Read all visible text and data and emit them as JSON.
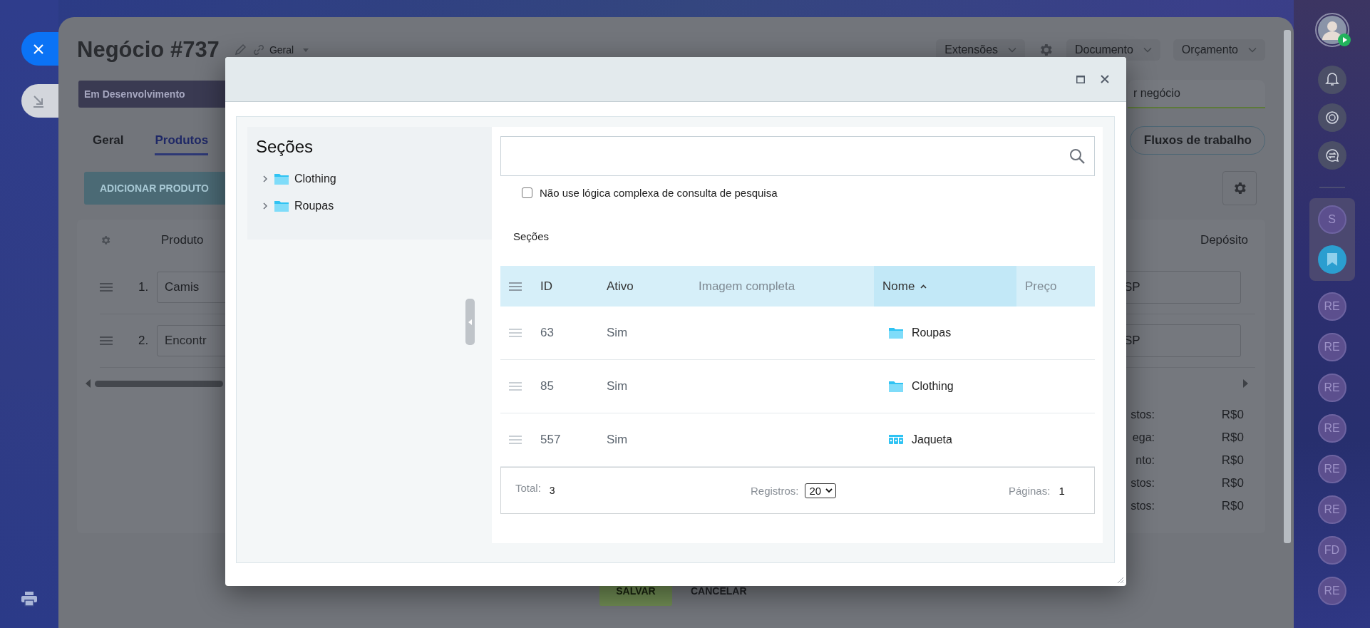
{
  "deal": {
    "title": "Negócio #737",
    "category": "Geral",
    "menus": [
      {
        "label": "Extensões"
      },
      {
        "label": "Documento"
      },
      {
        "label": "Orçamento"
      }
    ],
    "stage": "Em Desenvolvimento",
    "stage_action": "r negócio",
    "tabs": [
      {
        "label": "Geral",
        "selected": false
      },
      {
        "label": "Produtos",
        "selected": true
      }
    ],
    "workflow_button": "Fluxos de trabalho",
    "add_button": "ADICIONAR PRODUTO",
    "product_table": {
      "columns": [
        "Produto",
        "Depósito"
      ],
      "rows": [
        {
          "number": "1.",
          "product": "Camis",
          "warehouse": "SP"
        },
        {
          "number": "2.",
          "placeholder": "Encontr",
          "warehouse": "SP"
        }
      ]
    },
    "totals": [
      {
        "label": "stos:",
        "value": "R$0"
      },
      {
        "label": "ega:",
        "value": "R$0"
      },
      {
        "label": "nto:",
        "value": "R$0"
      },
      {
        "label": "stos:",
        "value": "R$0"
      },
      {
        "label": "stos:",
        "value": "R$0"
      }
    ],
    "buttons": [
      "SALVAR",
      "CANCELAR"
    ]
  },
  "dialog": {
    "tree": {
      "title": "Seções",
      "items": [
        {
          "label": "Clothing",
          "expanded": false
        },
        {
          "label": "Roupas",
          "expanded": false
        }
      ]
    },
    "option": {
      "label": "Não use lógica complexa de consulta de pesquisa",
      "checked": false
    },
    "section_label": "Seções",
    "table": {
      "columns": [
        {
          "label": "ID",
          "sortable": true,
          "sorted": false
        },
        {
          "label": "Ativo",
          "sortable": true,
          "sorted": false
        },
        {
          "label": "Imagem completa",
          "sortable": false,
          "sorted": false
        },
        {
          "label": "Nome",
          "sortable": true,
          "sorted": true
        },
        {
          "label": "Preço",
          "sortable": false,
          "sorted": false
        }
      ],
      "rows": [
        {
          "id": "63",
          "active": "Sim",
          "name": "Roupas",
          "kind": "section"
        },
        {
          "id": "85",
          "active": "Sim",
          "name": "Clothing",
          "kind": "section"
        },
        {
          "id": "557",
          "active": "Sim",
          "name": "Jaqueta",
          "kind": "product"
        }
      ]
    },
    "footer": {
      "total_label": "Total:",
      "total": "3",
      "page_size_label": "Registros:",
      "page_size": "20",
      "pages_label": "Páginas:",
      "pages": "1"
    }
  },
  "sidebar": {
    "items": [
      {
        "kind": "initials",
        "initials": "S"
      },
      {
        "kind": "bookmark"
      }
    ],
    "chats": [
      {
        "initials": "RE"
      },
      {
        "initials": "RE"
      },
      {
        "initials": "RE"
      },
      {
        "initials": "RE"
      },
      {
        "initials": "RE"
      },
      {
        "initials": "RE"
      },
      {
        "initials": "FD"
      },
      {
        "initials": "RE"
      }
    ]
  }
}
